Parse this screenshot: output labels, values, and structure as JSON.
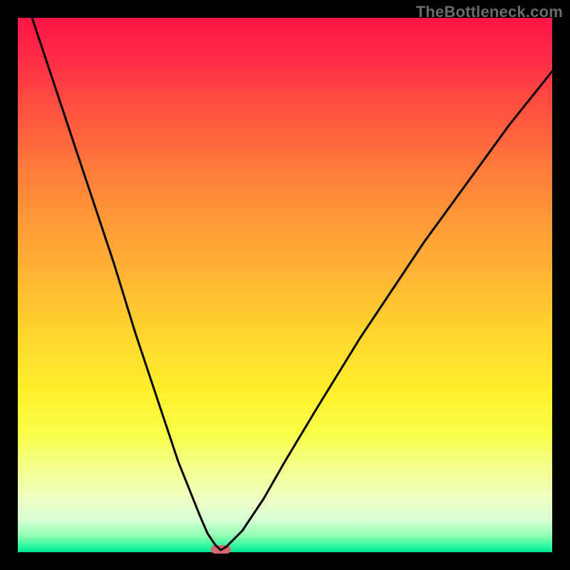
{
  "attribution": "TheBottleneck.com",
  "chart_data": {
    "type": "line",
    "title": "",
    "xlabel": "",
    "ylabel": "",
    "xlim": [
      0,
      100
    ],
    "ylim": [
      0,
      100
    ],
    "curve_min_x": 38,
    "curve_min_y": 0,
    "marker": {
      "x": 38,
      "y": 0.6,
      "shape": "rounded-rect",
      "color": "#d56a6e"
    },
    "x": [
      0.0,
      2.0,
      4.0,
      6.0,
      8.0,
      10.0,
      12.0,
      14.0,
      16.0,
      18.0,
      20.0,
      22.0,
      24.0,
      26.0,
      28.0,
      30.0,
      32.0,
      34.0,
      35.5,
      37.0,
      38.0,
      39.0,
      40.5,
      42.0,
      44.0,
      46.0,
      48.0,
      50.0,
      53.0,
      56.0,
      60.0,
      64.0,
      68.0,
      72.0,
      76.0,
      80.0,
      84.0,
      88.0,
      92.0,
      96.0,
      100.0
    ],
    "values": [
      108.0,
      102.0,
      96.0,
      90.0,
      84.0,
      78.0,
      72.0,
      66.0,
      60.0,
      54.0,
      47.5,
      41.0,
      35.0,
      29.0,
      23.0,
      17.0,
      12.0,
      7.0,
      3.5,
      1.3,
      0.4,
      1.0,
      2.5,
      4.0,
      7.0,
      10.0,
      13.5,
      17.0,
      22.0,
      27.0,
      33.5,
      40.0,
      46.0,
      52.0,
      58.0,
      63.5,
      69.0,
      74.5,
      80.0,
      85.0,
      90.0
    ],
    "gradient_stops": [
      {
        "pos": 0.0,
        "color": "#ff1546"
      },
      {
        "pos": 0.28,
        "color": "#ff7a3b"
      },
      {
        "pos": 0.6,
        "color": "#ffd82e"
      },
      {
        "pos": 0.84,
        "color": "#f3ff8a"
      },
      {
        "pos": 0.97,
        "color": "#8dffb1"
      },
      {
        "pos": 1.0,
        "color": "#00e58f"
      }
    ]
  }
}
